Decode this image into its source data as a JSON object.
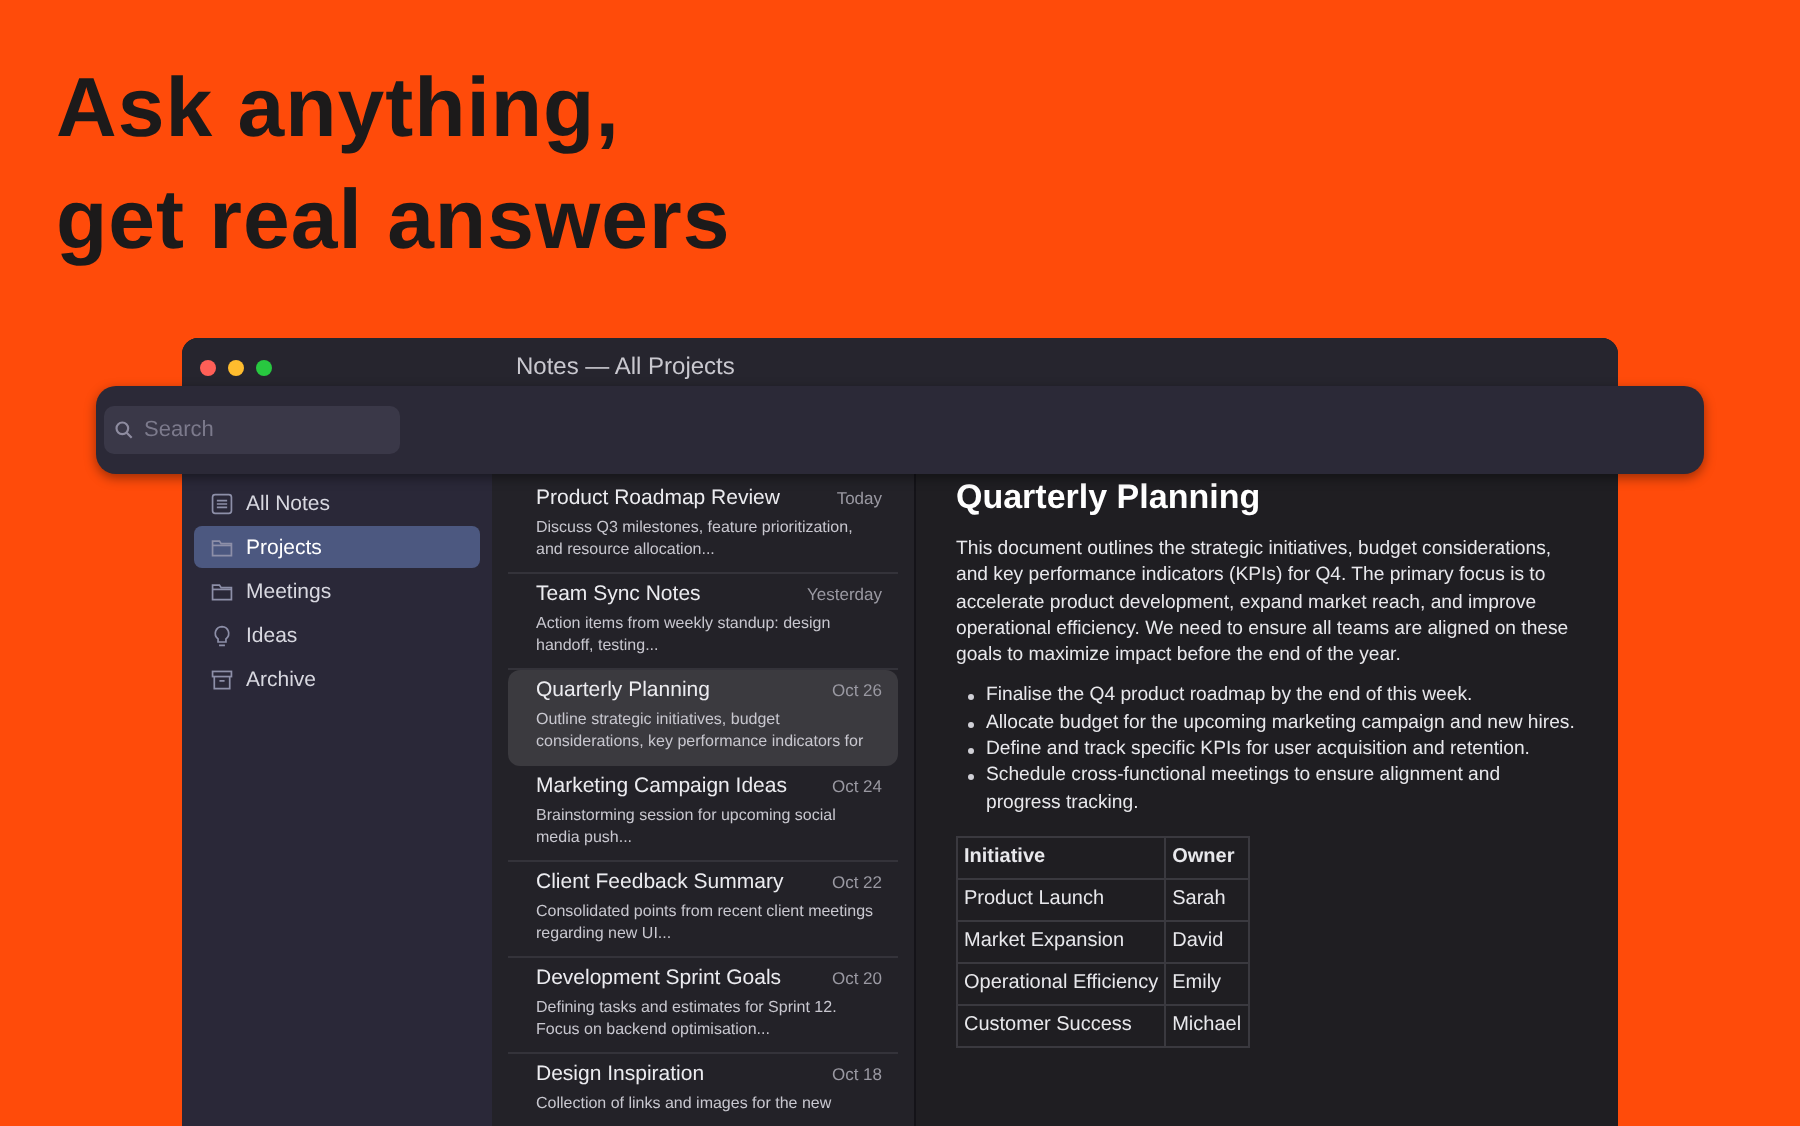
{
  "headline": [
    "Ask anything,",
    "get real answers"
  ],
  "window": {
    "title": "Notes — All Projects"
  },
  "search": {
    "placeholder": "Search"
  },
  "sidebar": {
    "items": [
      {
        "label": "All Notes",
        "selected": false
      },
      {
        "label": "Projects",
        "selected": true
      },
      {
        "label": "Meetings",
        "selected": false
      },
      {
        "label": "Ideas",
        "selected": false
      },
      {
        "label": "Archive",
        "selected": false
      }
    ]
  },
  "notes": [
    {
      "title": "Product Roadmap Review",
      "date": "Today",
      "preview": "Discuss Q3 milestones, feature prioritization, and resource allocation...",
      "selected": false
    },
    {
      "title": "Team Sync Notes",
      "date": "Yesterday",
      "preview": "Action items from weekly standup: design handoff, testing...",
      "selected": false
    },
    {
      "title": "Quarterly Planning",
      "date": "Oct 26",
      "preview": "Outline strategic initiatives, budget considerations, key performance indicators for",
      "selected": true
    },
    {
      "title": "Marketing Campaign Ideas",
      "date": "Oct 24",
      "preview": "Brainstorming session for upcoming social media push...",
      "selected": false
    },
    {
      "title": "Client Feedback Summary",
      "date": "Oct 22",
      "preview": "Consolidated points from recent client meetings regarding new UI...",
      "selected": false
    },
    {
      "title": "Development Sprint Goals",
      "date": "Oct 20",
      "preview": "Defining tasks and estimates for Sprint 12. Focus on backend optimisation...",
      "selected": false
    },
    {
      "title": "Design Inspiration",
      "date": "Oct 18",
      "preview": "Collection of links and images for the new",
      "selected": false
    }
  ],
  "document": {
    "title": "Quarterly Planning",
    "body": "This document outlines the strategic initiatives, budget considerations, and key performance indicators (KPIs) for Q4. The primary focus is to accelerate product development, expand market reach, and improve operational efficiency. We need to ensure all teams are aligned on these goals to maximize impact before the end of the year.",
    "bullets": [
      "Finalise the Q4 product roadmap by the end of this week.",
      "Allocate budget for the upcoming marketing campaign and new hires.",
      "Define and track specific KPIs for user acquisition and retention.",
      "Schedule cross-functional meetings to ensure alignment and progress tracking."
    ],
    "table": {
      "columns": [
        "Initiative",
        "Owner"
      ],
      "rows": [
        [
          "Product Launch",
          "Sarah"
        ],
        [
          "Market Expansion",
          "David"
        ],
        [
          "Operational Efficiency",
          "Emily"
        ],
        [
          "Customer Success",
          "Michael"
        ]
      ]
    }
  }
}
